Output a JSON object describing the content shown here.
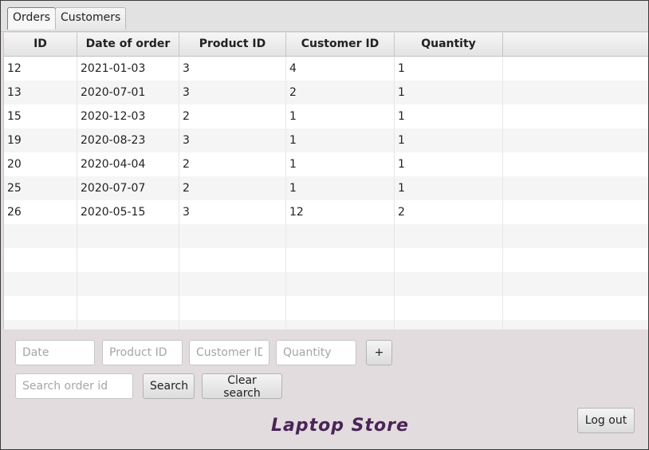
{
  "tabs": [
    {
      "label": "Orders",
      "active": true
    },
    {
      "label": "Customers",
      "active": false
    }
  ],
  "table": {
    "columns": [
      "ID",
      "Date of order",
      "Product ID",
      "Customer ID",
      "Quantity"
    ],
    "rows": [
      [
        "12",
        "2021-01-03",
        "3",
        "4",
        "1"
      ],
      [
        "13",
        "2020-07-01",
        "3",
        "2",
        "1"
      ],
      [
        "15",
        "2020-12-03",
        "2",
        "1",
        "1"
      ],
      [
        "19",
        "2020-08-23",
        "3",
        "1",
        "1"
      ],
      [
        "20",
        "2020-04-04",
        "2",
        "1",
        "1"
      ],
      [
        "25",
        "2020-07-07",
        "2",
        "1",
        "1"
      ],
      [
        "26",
        "2020-05-15",
        "3",
        "12",
        "2"
      ]
    ]
  },
  "form": {
    "date_placeholder": "Date",
    "product_placeholder": "Product ID",
    "customer_placeholder": "Customer ID",
    "quantity_placeholder": "Quantity",
    "add_label": "+",
    "search_placeholder": "Search order id",
    "search_label": "Search",
    "clear_label": "Clear search"
  },
  "footer": {
    "brand": "Laptop Store",
    "logout_label": "Log out"
  },
  "colors": {
    "active_tab_border": "#3a8fd8",
    "brand_text": "#4a2457",
    "panel_bg": "#e2dcde"
  }
}
